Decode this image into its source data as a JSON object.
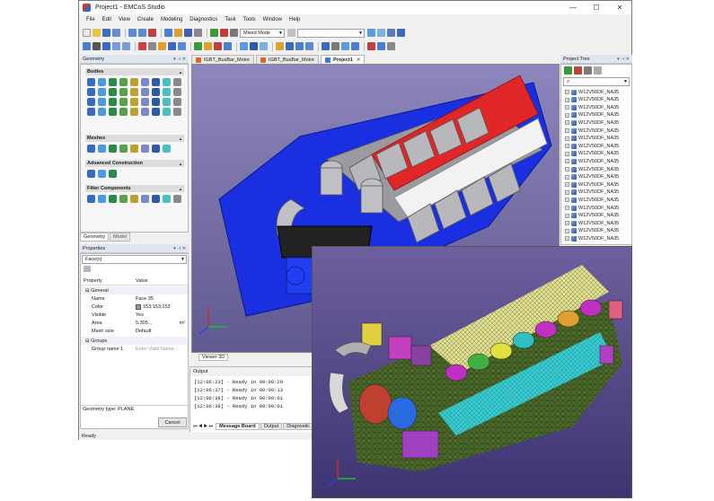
{
  "window": {
    "title": "Project1 - EMCoS Studio",
    "controls": [
      "—",
      "☐",
      "✕"
    ]
  },
  "menu": [
    "File",
    "Edit",
    "View",
    "Create",
    "Modeling",
    "Diagnostics",
    "Task",
    "Tools",
    "Window",
    "Help"
  ],
  "toolbar": {
    "mode_select": "Mixed Mode",
    "second_select": ""
  },
  "geometry_panel": {
    "title": "Geometry",
    "sections": {
      "bodies": "Bodies",
      "meshes": "Meshes",
      "advanced": "Advanced Construction",
      "filter": "Filter Components"
    },
    "tabs": [
      "Geometry",
      "Model"
    ]
  },
  "properties_panel": {
    "title": "Properties",
    "selector": "Face(s)",
    "col_property": "Property",
    "col_value": "Value",
    "group_general": "General",
    "rows": {
      "name": {
        "k": "Name",
        "v": "Face 35"
      },
      "color": {
        "k": "Color",
        "v": "153;153;153"
      },
      "visible": {
        "k": "Visible",
        "v": "Yes"
      },
      "area": {
        "k": "Area",
        "v": "5.305...",
        "unit": "m²"
      },
      "mesh": {
        "k": "Mesh size",
        "v": "Default"
      }
    },
    "group_groups": "Groups",
    "group_name": {
      "k": "Group name 1",
      "placeholder": "Enter Valid Name..."
    },
    "geometry_type": "Geometry type: PLANE",
    "cancel": "Cancel"
  },
  "editor_tabs": [
    {
      "label": "IGBT_BusBar_Motor",
      "active": false
    },
    {
      "label": "IGBT_BusBar_Motor",
      "active": false
    },
    {
      "label": "Project1",
      "active": true
    }
  ],
  "viewer_tab": "Viewer 3D",
  "output_panel": {
    "title": "Output",
    "lines": [
      "[12:06:23] - Ready in 00:00:29",
      "[12:06:37] - Ready in 00:00:13",
      "[12:06:38] - Ready in 00:00:01",
      "[12:06:38] - Ready in 00:00:01"
    ],
    "tabs": [
      "Message Board",
      "Output",
      "Diagnostic"
    ]
  },
  "project_tree": {
    "title": "Project Tree",
    "items": [
      "W12V50DF_NA35",
      "W12V50DF_NA35",
      "W12V50DF_NA35",
      "W12V50DF_NA35",
      "W12V50DF_NA35",
      "W12V50DF_NA35",
      "W12V50DF_NA35",
      "W12V50DF_NA35",
      "W12V50DF_NA35",
      "W12V50DF_NA35",
      "W12V50DF_NA35",
      "W12V50DF_NA35",
      "W12V50DF_NA35",
      "W12V50DF_NA35",
      "W12V50DF_NA35",
      "W12V50DF_NA35",
      "W12V50DF_NA35",
      "W12V50DF_NA35",
      "W12V50DF_NA35",
      "W12V50DF_NA35"
    ]
  },
  "status": "Ready",
  "colors": {
    "accent": "#2c68c6",
    "viewer_bg": "#7d77b0",
    "engine_blue": "#1530e0",
    "engine_red": "#e02020",
    "mesh_green": "#4a6a2a"
  }
}
